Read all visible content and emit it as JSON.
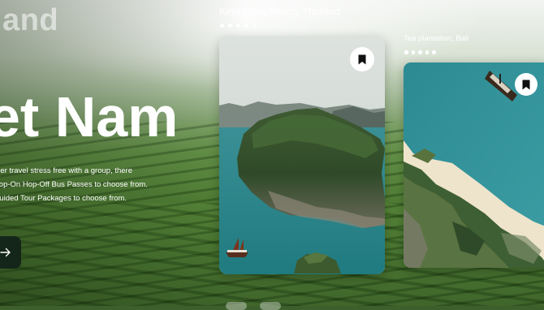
{
  "hero": {
    "previous_country": "land",
    "title": "et Nam",
    "description_lines": [
      "rather travel stress free with a group, there",
      "e Hop-On Hop-Off  Bus Passes to choose from.",
      "e Guided Tour Packages to choose from."
    ],
    "next_icon": "arrow-right-icon"
  },
  "cards": [
    {
      "label": "Kekingking Beach, Thailand",
      "dots_total": 5,
      "dots_active": 4,
      "icon": "bookmark-icon"
    },
    {
      "label": "Tea plantation, Bali",
      "dots_total": 4,
      "dots_active": 4,
      "icon": "bookmark-icon"
    }
  ],
  "colors": {
    "button_dark": "#14261a",
    "text_white": "#ffffff",
    "water_teal": "#2f8c92"
  }
}
